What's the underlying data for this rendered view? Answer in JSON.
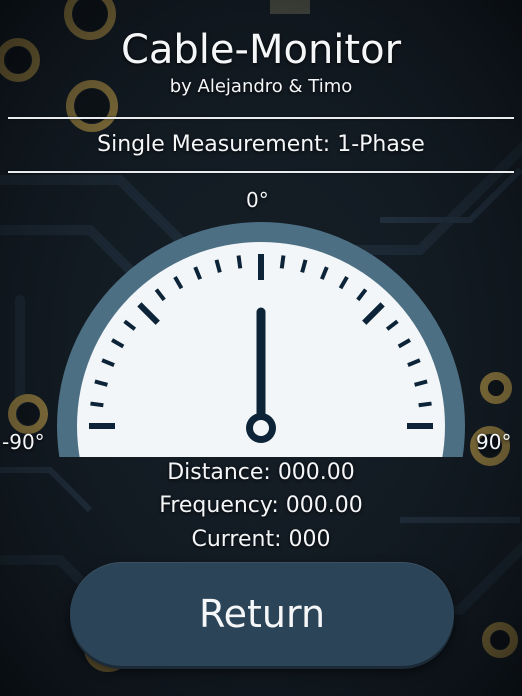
{
  "header": {
    "title": "Cable-Monitor",
    "subtitle": "by Alejandro & Timo"
  },
  "mode_label": "Single Measurement: 1-Phase",
  "gauge": {
    "label_top": "0°",
    "label_left": "-90°",
    "label_right": "90°",
    "needle_angle_deg": 0,
    "colors": {
      "rim": "#4d6f84",
      "face": "#f2f6f8",
      "ticks": "#0d2438",
      "needle": "#0d2438"
    }
  },
  "readings": {
    "distance_label": "Distance:",
    "distance_value": "000.00",
    "frequency_label": "Frequency:",
    "frequency_value": "000.00",
    "current_label": "Current:",
    "current_value": "000"
  },
  "return_button": {
    "label": "Return"
  }
}
